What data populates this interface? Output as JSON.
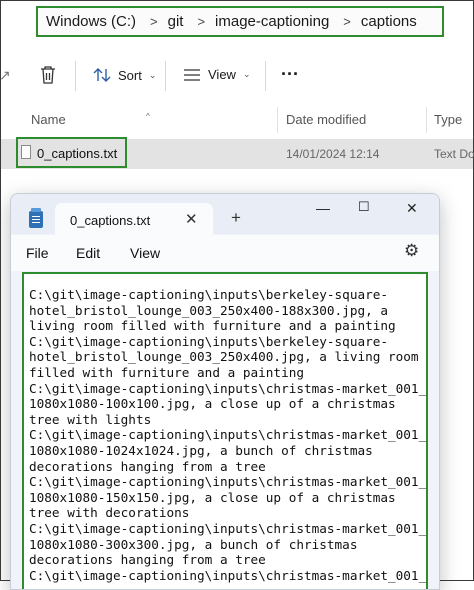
{
  "explorer": {
    "breadcrumb": [
      "Windows (C:)",
      "git",
      "image-captioning",
      "captions"
    ],
    "toolbar": {
      "sort_label": "Sort",
      "view_label": "View",
      "more_label": "···"
    },
    "columns": {
      "name": "Name",
      "date_modified": "Date modified",
      "type": "Type"
    },
    "files": [
      {
        "name": "0_captions.txt",
        "date_modified": "14/01/2024 12:14",
        "type": "Text Do"
      }
    ]
  },
  "notepad": {
    "tab_title": "0_captions.txt",
    "menu": [
      "File",
      "Edit",
      "View"
    ],
    "content_lines": [
      "C:\\git\\image-captioning\\inputs\\berkeley-square-",
      "hotel_bristol_lounge_003_250x400-188x300.jpg, a",
      "living room filled with furniture and a painting",
      "C:\\git\\image-captioning\\inputs\\berkeley-square-",
      "hotel_bristol_lounge_003_250x400.jpg, a living room",
      "filled with furniture and a painting",
      "C:\\git\\image-captioning\\inputs\\christmas-market_001_",
      "1080x1080-100x100.jpg, a close up of a christmas",
      "tree with lights",
      "C:\\git\\image-captioning\\inputs\\christmas-market_001_",
      "1080x1080-1024x1024.jpg, a bunch of christmas",
      "decorations hanging from a tree",
      "C:\\git\\image-captioning\\inputs\\christmas-market_001_",
      "1080x1080-150x150.jpg, a close up of a christmas",
      "tree with decorations",
      "C:\\git\\image-captioning\\inputs\\christmas-market_001_",
      "1080x1080-300x300.jpg, a bunch of christmas",
      "decorations hanging from a tree",
      "C:\\git\\image-captioning\\inputs\\christmas-market_001_"
    ]
  },
  "colors": {
    "highlight_border": "#2e8b2e",
    "selected_row": "#e3e3e3",
    "notepad_icon": "#2f6fb3"
  }
}
